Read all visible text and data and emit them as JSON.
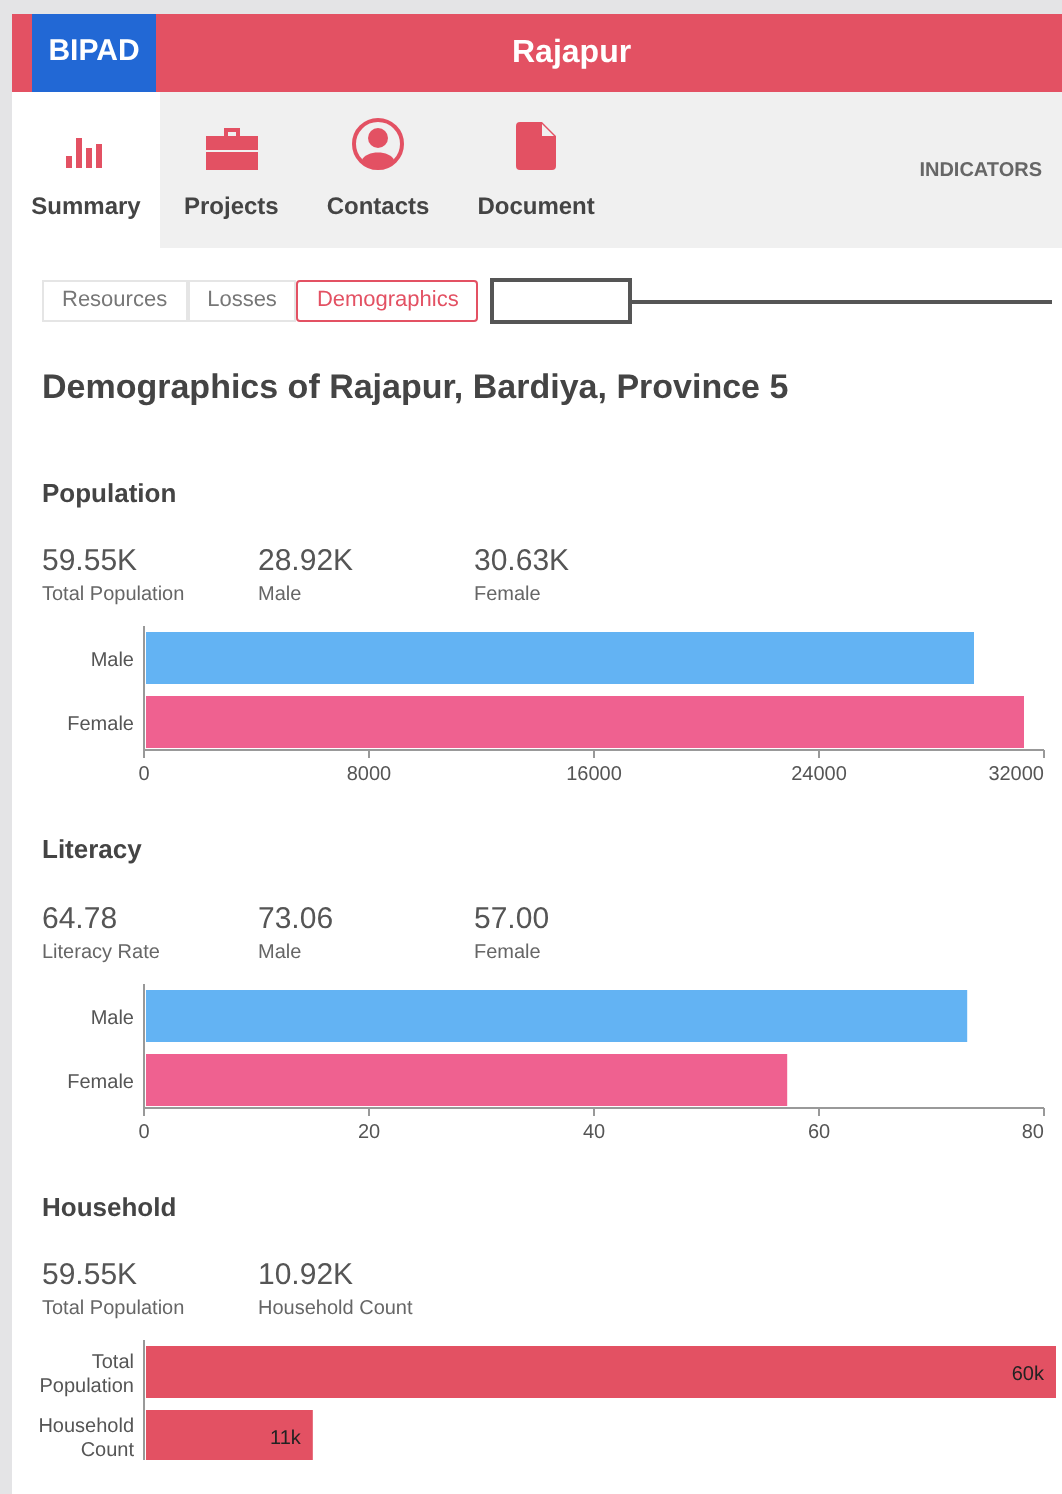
{
  "header": {
    "logo": "BIPAD",
    "title": "Rajapur"
  },
  "nav": {
    "items": [
      {
        "label": "Summary",
        "kind": "chart",
        "selected": true
      },
      {
        "label": "Projects",
        "kind": "briefcase",
        "selected": false
      },
      {
        "label": "Contacts",
        "kind": "person",
        "selected": false
      },
      {
        "label": "Document",
        "kind": "document",
        "selected": false
      }
    ],
    "indicators": "INDICATORS"
  },
  "tabs": [
    {
      "label": "Resources",
      "selected": false
    },
    {
      "label": "Losses",
      "selected": false
    },
    {
      "label": "Demographics",
      "selected": true
    }
  ],
  "heading": "Demographics of Rajapur, Bardiya, Province 5",
  "sections": [
    {
      "title": "Population",
      "stats": [
        {
          "value": "59.55K",
          "label": "Total Population"
        },
        {
          "value": "28.92K",
          "label": "Male"
        },
        {
          "value": "30.63K",
          "label": "Female"
        }
      ],
      "chart_data": {
        "type": "bar",
        "orientation": "horizontal",
        "categories": [
          "Male",
          "Female"
        ],
        "values": [
          29440,
          31220
        ],
        "colors": [
          "#63b3f3",
          "#ef6190"
        ],
        "xlim": [
          0,
          32000
        ],
        "xticks": [
          0,
          8000,
          16000,
          24000,
          32000
        ]
      }
    },
    {
      "title": "Literacy",
      "stats": [
        {
          "value": "64.78",
          "label": "Literacy Rate"
        },
        {
          "value": "73.06",
          "label": "Male"
        },
        {
          "value": "57.00",
          "label": "Female"
        }
      ],
      "chart_data": {
        "type": "bar",
        "orientation": "horizontal",
        "categories": [
          "Male",
          "Female"
        ],
        "values": [
          73,
          57
        ],
        "colors": [
          "#63b3f3",
          "#ef6190"
        ],
        "xlim": [
          0,
          80
        ],
        "xticks": [
          0,
          20,
          40,
          60,
          80
        ]
      }
    },
    {
      "title": "Household",
      "stats": [
        {
          "value": "59.55K",
          "label": "Total Population"
        },
        {
          "value": "10.92K",
          "label": "Household Count"
        }
      ],
      "chart_data": {
        "type": "bar",
        "orientation": "horizontal",
        "categories": [
          "Total Population",
          "Household Count"
        ],
        "values": [
          60000,
          11000
        ],
        "colors": [
          "#e35163",
          "#e35163"
        ],
        "value_labels": [
          "60k",
          "11k"
        ]
      }
    }
  ]
}
